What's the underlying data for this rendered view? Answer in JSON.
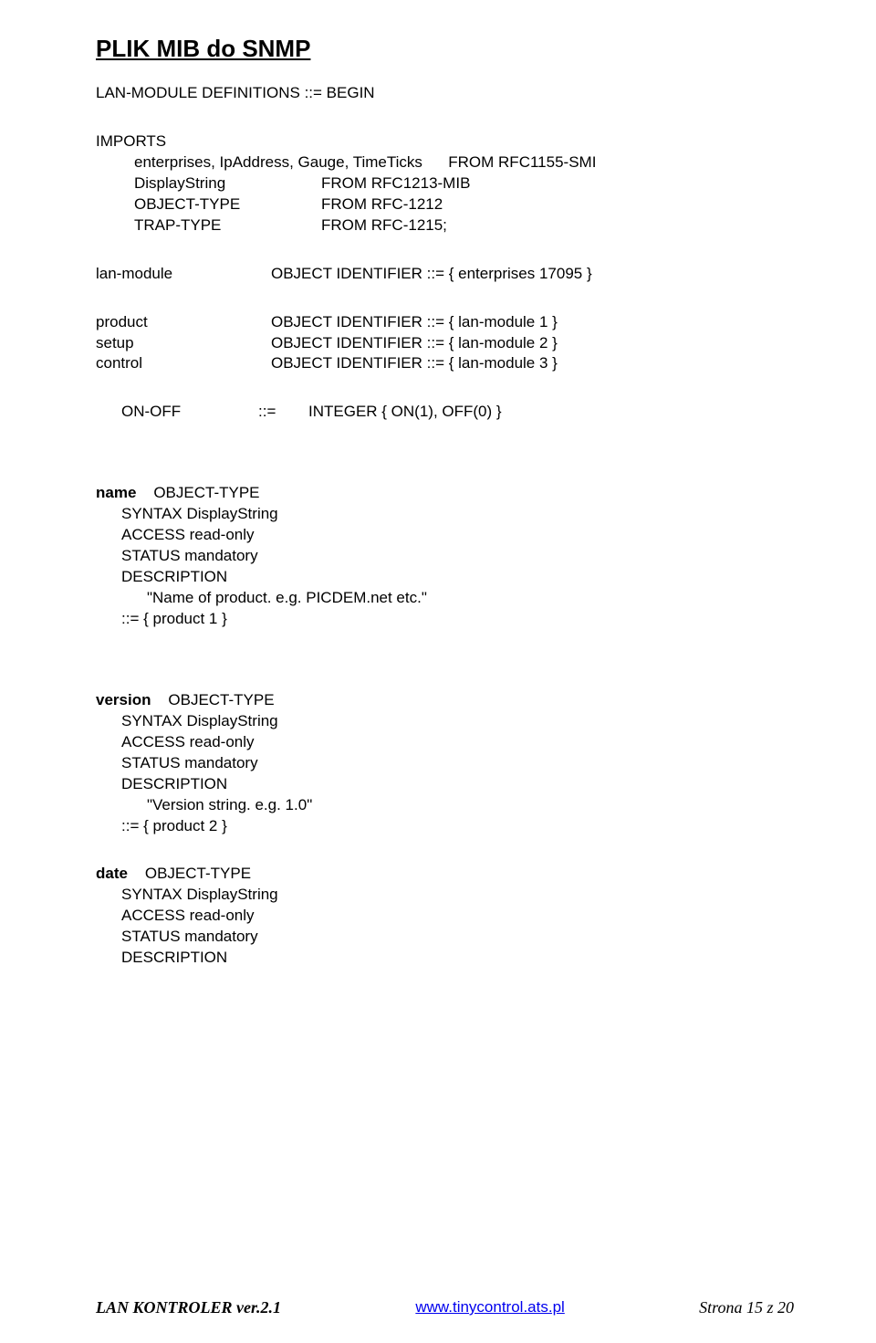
{
  "title": "PLIK MIB do SNMP",
  "defs": "LAN-MODULE DEFINITIONS ::= BEGIN",
  "imports": {
    "label": "IMPORTS",
    "enterprises": "enterprises, IpAddress, Gauge, TimeTicks",
    "enterprises_from": "FROM RFC1155-SMI",
    "display": "DisplayString",
    "display_from": "FROM RFC1213-MIB",
    "objtype": "OBJECT-TYPE",
    "objtype_from": "FROM RFC-1212",
    "traptype": "TRAP-TYPE",
    "traptype_from": "FROM RFC-1215;"
  },
  "lanmod": {
    "name": "lan-module",
    "def": "OBJECT IDENTIFIER ::= { enterprises 17095 }"
  },
  "ids": {
    "product_name": "product",
    "product_def": "OBJECT IDENTIFIER ::= { lan-module 1 }",
    "setup_name": "setup",
    "setup_def": "OBJECT IDENTIFIER ::= { lan-module 2 }",
    "control_name": "control",
    "control_def": "OBJECT IDENTIFIER ::= { lan-module 3 }"
  },
  "onoff": {
    "name": "ON-OFF",
    "op": "::=",
    "def": "INTEGER { ON(1), OFF(0) }"
  },
  "name_obj": {
    "header": "name    OBJECT-TYPE",
    "syntax": "SYNTAX DisplayString",
    "access": "ACCESS read-only",
    "status": "STATUS mandatory",
    "desc_label": "DESCRIPTION",
    "desc_text": "\"Name of product. e.g. PICDEM.net etc.\"",
    "assign": "::= { product 1 }"
  },
  "version_obj": {
    "header": "version    OBJECT-TYPE",
    "syntax": "SYNTAX DisplayString",
    "access": "ACCESS read-only",
    "status": "STATUS mandatory",
    "desc_label": "DESCRIPTION",
    "desc_text": "\"Version string. e.g. 1.0\"",
    "assign": "::= { product 2 }"
  },
  "date_obj": {
    "header": "date    OBJECT-TYPE",
    "syntax": "SYNTAX DisplayString",
    "access": "ACCESS read-only",
    "status": "STATUS mandatory",
    "desc_label": "DESCRIPTION"
  },
  "footer": {
    "left": "LAN KONTROLER  ver.2.1",
    "center": "www.tinycontrol.ats.pl",
    "right": "Strona 15 z 20"
  }
}
